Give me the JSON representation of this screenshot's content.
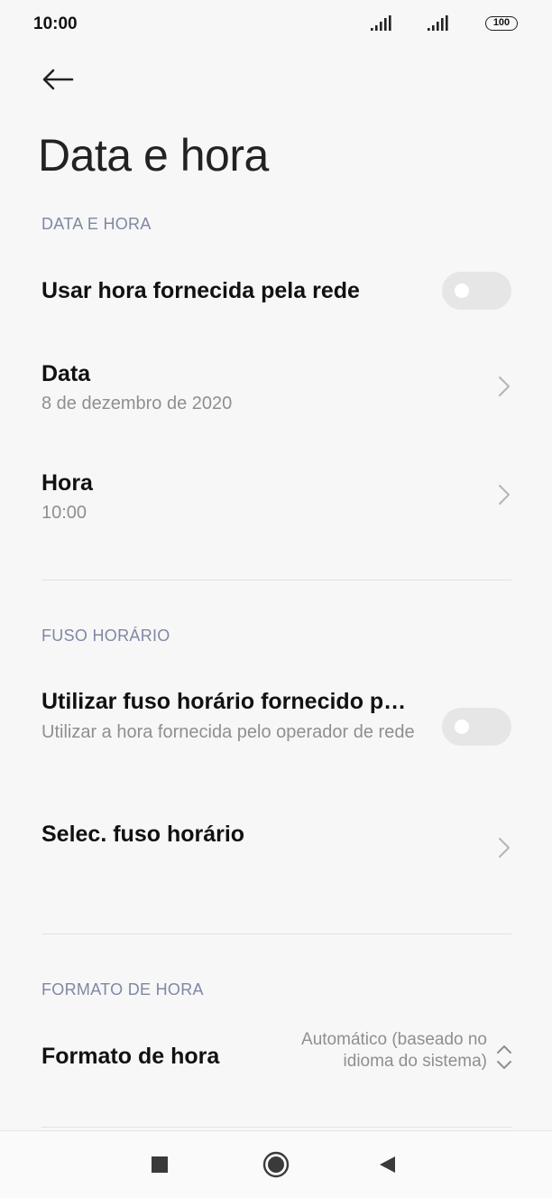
{
  "status_bar": {
    "time": "10:00",
    "battery": "100"
  },
  "header": {
    "title": "Data e hora"
  },
  "sections": {
    "date_time": {
      "header": "DATA E HORA",
      "network_time": {
        "label": "Usar hora fornecida pela rede",
        "enabled": false
      },
      "date": {
        "label": "Data",
        "value": "8 de dezembro de 2020"
      },
      "time": {
        "label": "Hora",
        "value": "10:00"
      }
    },
    "time_zone": {
      "header": "FUSO HORÁRIO",
      "network_zone": {
        "label": "Utilizar fuso horário fornecido p…",
        "description": "Utilizar a hora fornecida pelo operador de rede",
        "enabled": false
      },
      "select_zone": {
        "label": "Selec. fuso horário"
      }
    },
    "time_format": {
      "header": "FORMATO DE HORA",
      "format": {
        "label": "Formato de hora",
        "value": "Automático (baseado no idioma do sistema)"
      }
    }
  },
  "icons": {
    "back": "arrow-left-icon",
    "chevron": "chevron-right-icon",
    "updown": "chevron-up-down-icon",
    "nav": [
      "recents-square-icon",
      "home-circle-icon",
      "back-triangle-icon"
    ]
  },
  "colors": {
    "background": "#f7f7f7",
    "section_header": "#7f88a3",
    "toggle_off": "#e6e6e6",
    "secondary_text": "#8f8f8f"
  }
}
